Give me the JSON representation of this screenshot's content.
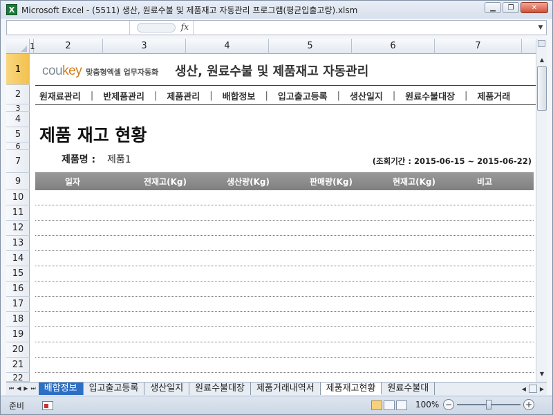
{
  "window": {
    "title": "Microsoft Excel - (5511) 생산, 원료수불 및 제품재고 자동관리 프로그램(평균입출고량).xlsm",
    "app_icon": "X"
  },
  "formula_bar": {
    "name_box": "",
    "fx_label": "fx",
    "formula": ""
  },
  "columns": [
    "1",
    "2",
    "3",
    "4",
    "5",
    "6",
    "7"
  ],
  "rows": [
    "1",
    "2",
    "3",
    "4",
    "5",
    "6",
    "7",
    "9",
    "10",
    "11",
    "12",
    "13",
    "14",
    "15",
    "16",
    "17",
    "18",
    "19",
    "20",
    "21",
    "22"
  ],
  "sheet": {
    "logo_cou": "cou",
    "logo_key": "key",
    "logo_sub": "맞춤형엑셀 업무자동화",
    "main_title": "생산, 원료수불 및 제품재고 자동관리",
    "nav": [
      "원재료관리",
      "반제품관리",
      "제품관리",
      "배합정보",
      "입고출고등록",
      "생산일지",
      "원료수불대장",
      "제품거래"
    ],
    "page_title": "제품 재고 현황",
    "product_label": "제품명 :",
    "product_value": "제품1",
    "period": "(조회기간 : 2015-06-15 ~ 2015-06-22)",
    "table_headers": [
      "일자",
      "전재고(Kg)",
      "생산량(Kg)",
      "판매량(Kg)",
      "현재고(Kg)",
      "비고"
    ]
  },
  "tabs": [
    "배합정보",
    "입고출고등록",
    "생산일지",
    "원료수불대장",
    "제품거래내역서",
    "제품재고현황",
    "원료수불대"
  ],
  "active_tab": "제품재고현황",
  "status": {
    "ready": "준비",
    "zoom": "100%",
    "zoom_minus": "−",
    "zoom_plus": "+"
  },
  "colors": {
    "selected_row_header": "#f2c04e",
    "table_header_bg": "#8a8a8a",
    "logo_key": "#d07c1a",
    "first_tab": "#2d6fc4"
  }
}
